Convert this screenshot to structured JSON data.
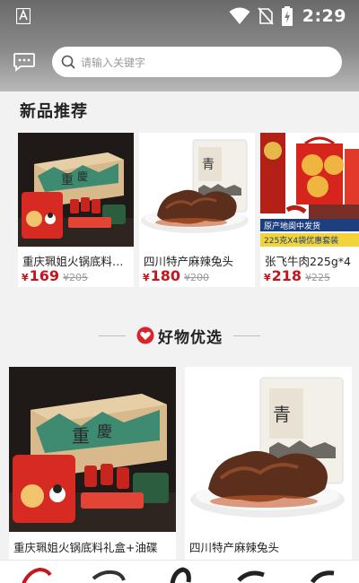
{
  "status_bar": {
    "time": "2:29"
  },
  "search": {
    "placeholder": "请输入关键字"
  },
  "sections": {
    "new_title": "新品推荐",
    "featured_title": "好物优选"
  },
  "new_products": [
    {
      "name": "重庆珮姐火锅底料…",
      "price_symbol": "¥",
      "price": "169",
      "original": "¥205"
    },
    {
      "name": "四川特产麻辣兔头",
      "price_symbol": "¥",
      "price": "180",
      "original": "¥200"
    },
    {
      "name": "张飞牛肉225g*4",
      "price_symbol": "¥",
      "price": "218",
      "original": "¥225"
    }
  ],
  "featured_products": [
    {
      "name": "重庆珮姐火锅底料礼盒+油碟"
    },
    {
      "name": "四川特产麻辣兔头"
    }
  ],
  "bottom_nav": [
    {
      "icon": "home-icon"
    },
    {
      "icon": "category-icon"
    },
    {
      "icon": "discover-icon"
    },
    {
      "icon": "cart-icon"
    },
    {
      "icon": "profile-icon"
    }
  ]
}
